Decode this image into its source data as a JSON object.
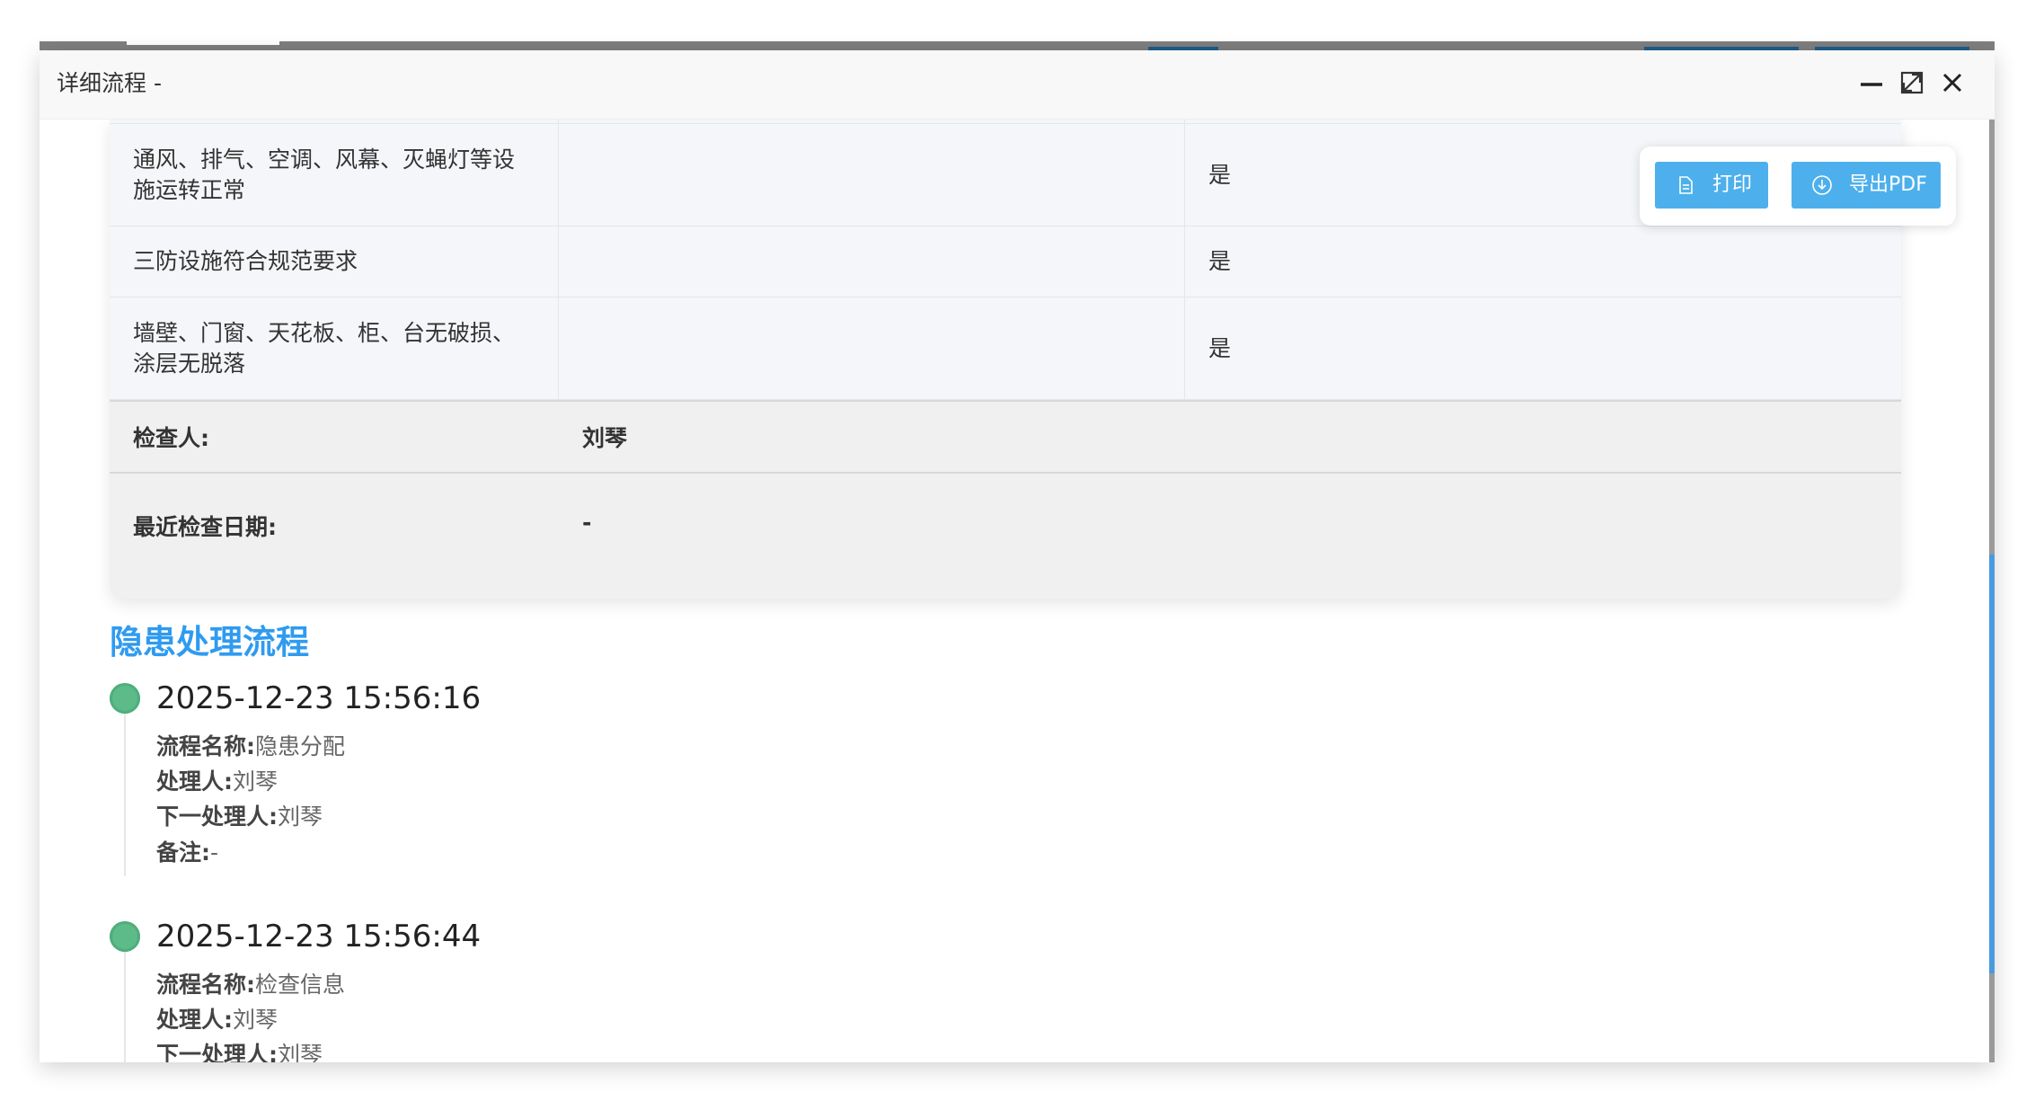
{
  "dialog": {
    "title": "详细流程 -"
  },
  "window_controls": {
    "minimize_icon": "minimize-icon",
    "maximize_icon": "maximize-icon",
    "close_icon": "close-icon"
  },
  "table": {
    "rows": [
      {
        "item": "通风、排气、空调、风幕、灭蝇灯等设施运转正常",
        "note": "",
        "result": "是"
      },
      {
        "item": "三防设施符合规范要求",
        "note": "",
        "result": "是"
      },
      {
        "item": "墙壁、门窗、天花板、柜、台无破损、涂层无脱落",
        "note": "",
        "result": "是"
      }
    ],
    "inspector_label": "检查人:",
    "inspector_value": "刘琴",
    "last_date_label": "最近检查日期:",
    "last_date_value": "-"
  },
  "actions": {
    "print_label": "打印",
    "export_label": "导出PDF",
    "accent_color": "#4db0ec"
  },
  "process": {
    "title": "隐患处理流程",
    "title_color": "#2f9bf0",
    "field_labels": {
      "name": "流程名称:",
      "handler": "处理人:",
      "next_handler": "下一处理人:",
      "remark": "备注:"
    },
    "items": [
      {
        "time": "2025-12-23 15:56:16",
        "name": "隐患分配",
        "handler": "刘琴",
        "next_handler": "刘琴",
        "remark": "-"
      },
      {
        "time": "2025-12-23 15:56:44",
        "name": "检查信息",
        "handler": "刘琴",
        "next_handler": "刘琴",
        "remark": "-"
      }
    ],
    "dot_color": "#5dbb8a"
  }
}
